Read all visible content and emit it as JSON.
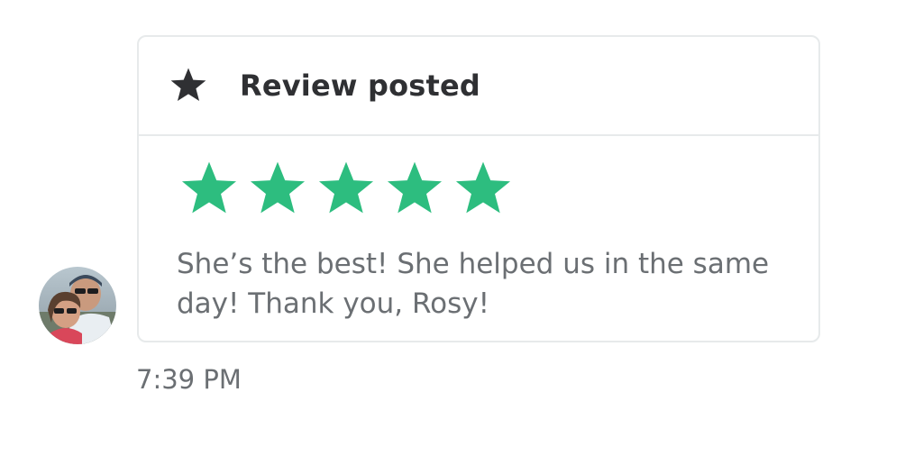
{
  "message": {
    "avatar_icon": "user-photo-avatar",
    "card": {
      "header": {
        "icon": "star-icon",
        "title": "Review posted"
      },
      "rating": {
        "value": 5,
        "max": 5,
        "color": "#2dbd7f"
      },
      "review_text": "She’s the best! She helped us in the same day! Thank you, Rosy!"
    },
    "timestamp": "7:39 PM"
  },
  "colors": {
    "star_filled": "#2dbd7f",
    "header_icon": "#2f3033",
    "text_muted": "#6b6f73",
    "border": "#e7eaeb"
  }
}
